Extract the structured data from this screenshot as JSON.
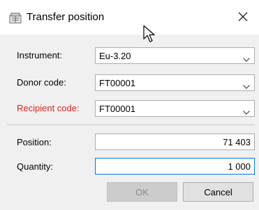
{
  "window": {
    "title": "Transfer position",
    "icon": "transfer-icon",
    "close_icon": "close-icon"
  },
  "form": {
    "instrument": {
      "label": "Instrument:",
      "value": "Eu-3.20"
    },
    "donor_code": {
      "label": "Donor code:",
      "value": "FT00001"
    },
    "recipient_code": {
      "label": "Recipient code:",
      "value": "FT00001",
      "label_color": "#e0201e"
    },
    "position": {
      "label": "Position:",
      "value": "71 403"
    },
    "quantity": {
      "label": "Quantity:",
      "value": "1 000"
    }
  },
  "buttons": {
    "ok_label": "OK",
    "cancel_label": "Cancel"
  },
  "colors": {
    "focus_border": "#0078d7",
    "error_label": "#e0201e"
  }
}
